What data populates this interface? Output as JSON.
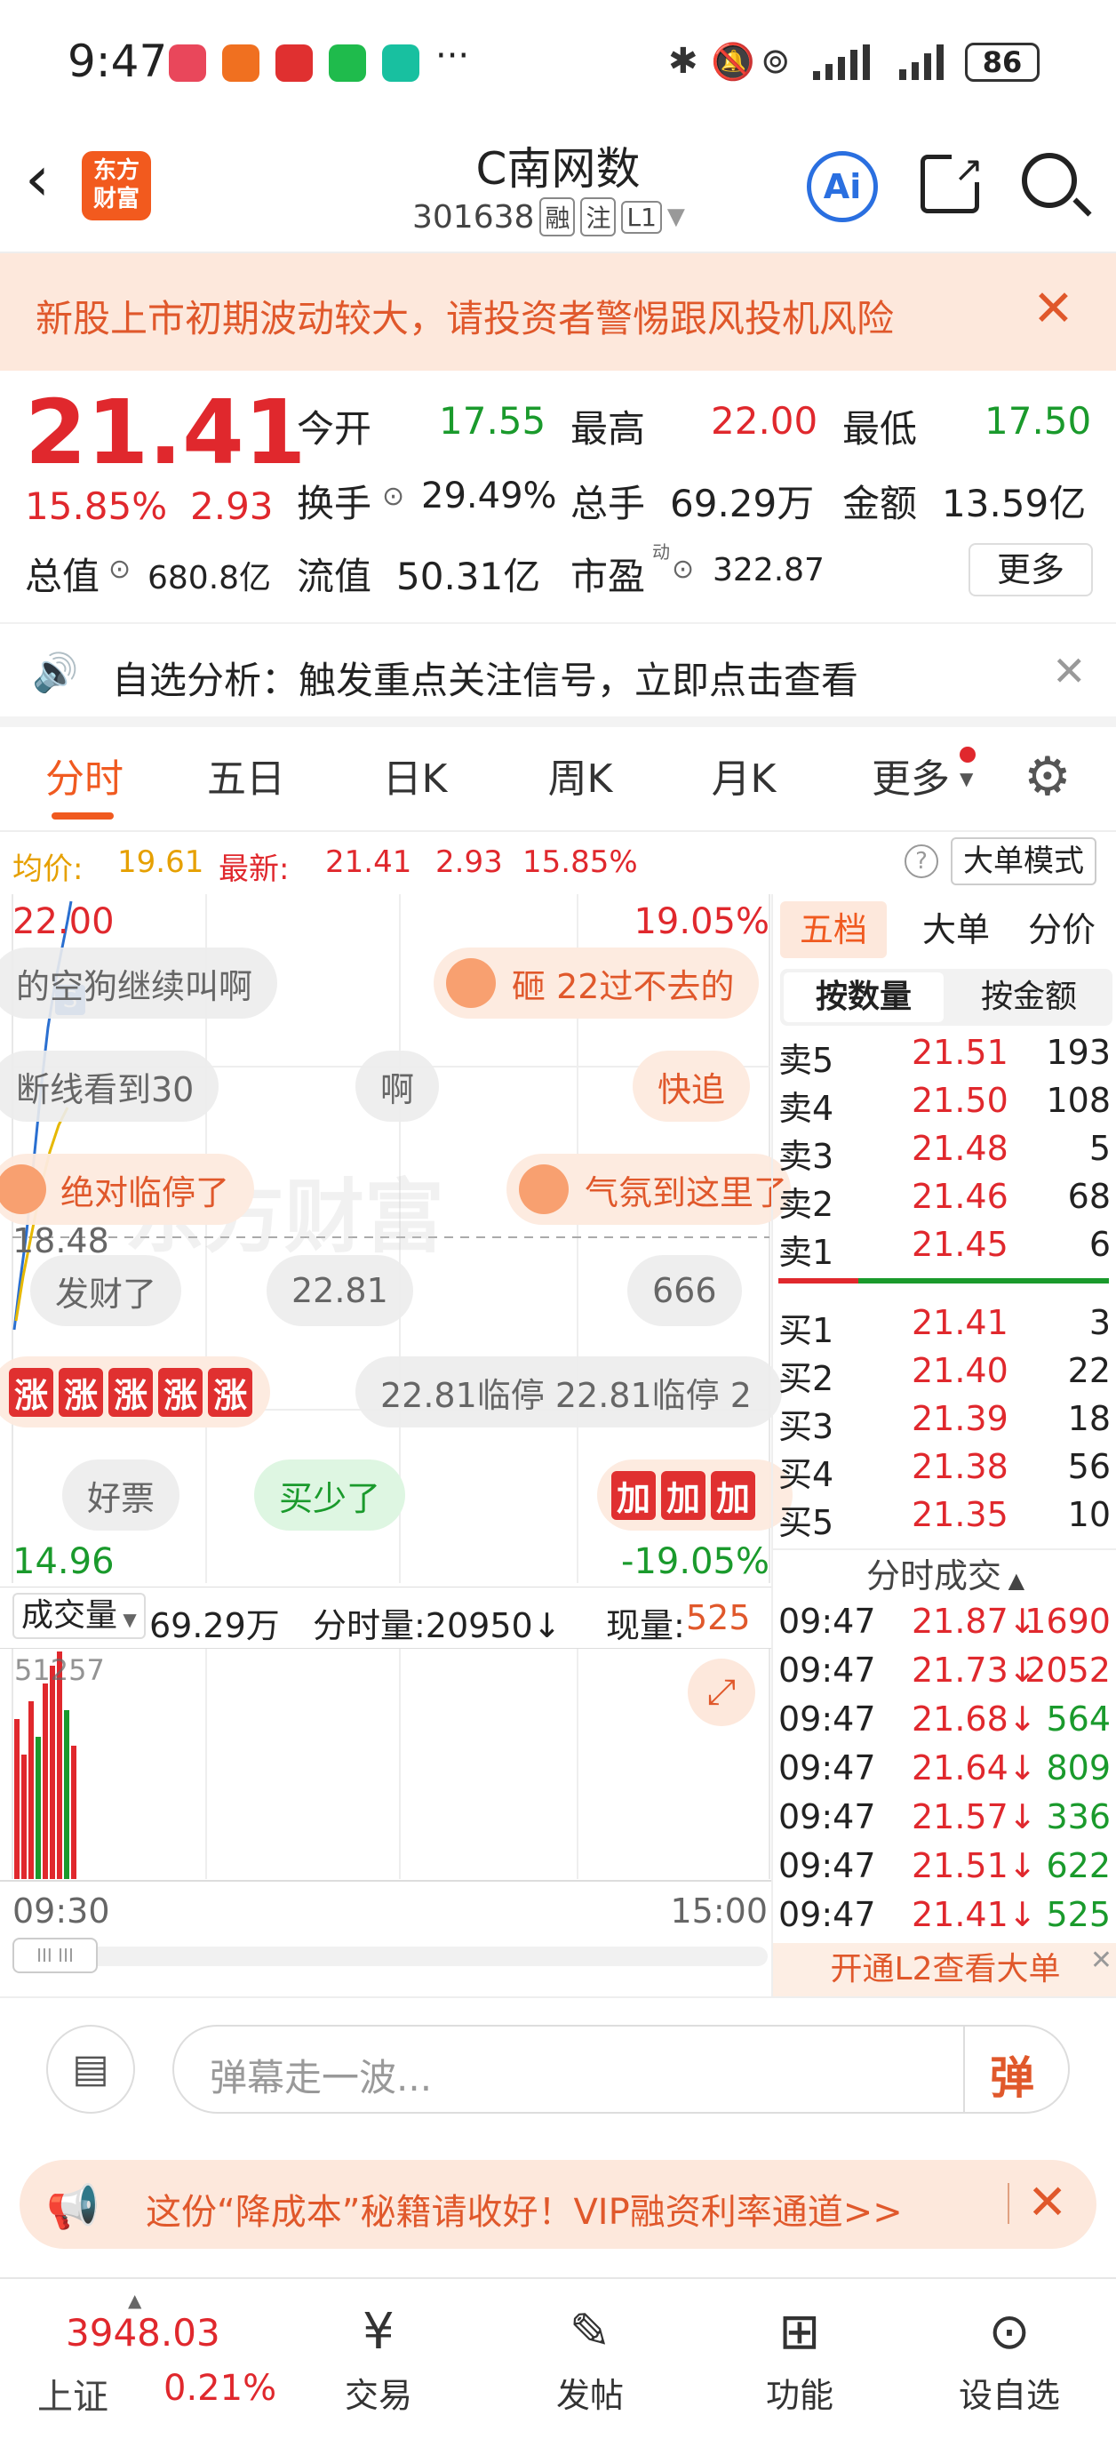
{
  "status": {
    "time": "9:47",
    "battery": "86",
    "more": "···"
  },
  "nav": {
    "title": "C南网数",
    "code": "301638",
    "tag_rong": "融",
    "tag_zhu": "注",
    "tag_level": "L1",
    "logo_line1": "东方",
    "logo_line2": "财富",
    "ai": "Ai"
  },
  "warning": {
    "text": "新股上市初期波动较大，请投资者警惕跟风投机风险"
  },
  "quote": {
    "price": "21.41",
    "pct": "15.85%",
    "change": "2.93",
    "open_label": "今开",
    "open": "17.55",
    "high_label": "最高",
    "high": "22.00",
    "low_label": "最低",
    "low": "17.50",
    "turnover_label": "换手",
    "turnover": "29.49%",
    "volume_label": "总手",
    "volume": "69.29万",
    "amount_label": "金额",
    "amount": "13.59亿",
    "mcap_label": "总值",
    "mcap": "680.8亿",
    "float_label": "流值",
    "float": "50.31亿",
    "pe_label": "市盈",
    "pe_sup": "动",
    "pe": "322.87",
    "more_btn": "更多"
  },
  "signal": {
    "text": "自选分析：触发重点关注信号，立即点击查看"
  },
  "ktabs": [
    "分时",
    "五日",
    "日K",
    "周K",
    "月K",
    "更多"
  ],
  "avg": {
    "avg_label": "均价:",
    "avg": "19.61",
    "latest_label": "最新:",
    "latest": "21.41",
    "chg": "2.93",
    "pct": "15.85%",
    "mode_btn": "大单模式",
    "help": "?"
  },
  "chart": {
    "top_price": "22.00",
    "top_pct": "19.05%",
    "mid_price": "18.48",
    "bottom_price": "14.96",
    "bottom_pct": "-19.05%",
    "watermark": "东方财富",
    "s_marker": "S",
    "vol_label": "成交量",
    "vol_total": "69.29万",
    "fs_label": "分时量:20950↓",
    "now_label": "现量:",
    "now_val": "525",
    "vol_max": "51257",
    "time_start": "09:30",
    "time_end": "15:00"
  },
  "danmaku": [
    {
      "text": "的空狗继续叫啊"
    },
    {
      "text": "砸 22过不去的"
    },
    {
      "text": "断线看到30"
    },
    {
      "text": "啊"
    },
    {
      "text": "快追"
    },
    {
      "text": "绝对临停了"
    },
    {
      "text": "气氛到这里了"
    },
    {
      "text": "发财了"
    },
    {
      "text": "22.81"
    },
    {
      "text": "666"
    },
    {
      "text": "22.81临停  22.81临停  2"
    },
    {
      "text": "好票"
    },
    {
      "text": "买少了"
    }
  ],
  "zhang": "涨",
  "jia": "加",
  "book": {
    "tabs": [
      "五档",
      "大单",
      "分价"
    ],
    "sub_tabs": [
      "按数量",
      "按金额"
    ],
    "asks": [
      {
        "label": "卖5",
        "price": "21.51",
        "qty": "193"
      },
      {
        "label": "卖4",
        "price": "21.50",
        "qty": "108"
      },
      {
        "label": "卖3",
        "price": "21.48",
        "qty": "5"
      },
      {
        "label": "卖2",
        "price": "21.46",
        "qty": "68"
      },
      {
        "label": "卖1",
        "price": "21.45",
        "qty": "6"
      }
    ],
    "bids": [
      {
        "label": "买1",
        "price": "21.41",
        "qty": "3"
      },
      {
        "label": "买2",
        "price": "21.40",
        "qty": "22"
      },
      {
        "label": "买3",
        "price": "21.39",
        "qty": "18"
      },
      {
        "label": "买4",
        "price": "21.38",
        "qty": "56"
      },
      {
        "label": "买5",
        "price": "21.35",
        "qty": "10"
      }
    ],
    "trades_title": "分时成交",
    "trades": [
      {
        "t": "09:47",
        "p": "21.87↓",
        "v": "1690"
      },
      {
        "t": "09:47",
        "p": "21.73↓",
        "v": "2052"
      },
      {
        "t": "09:47",
        "p": "21.68↓",
        "v": "564"
      },
      {
        "t": "09:47",
        "p": "21.64↓",
        "v": "809"
      },
      {
        "t": "09:47",
        "p": "21.57↓",
        "v": "336"
      },
      {
        "t": "09:47",
        "p": "21.51↓",
        "v": "622"
      },
      {
        "t": "09:47",
        "p": "21.41↓",
        "v": "525"
      }
    ],
    "l2": "开通L2查看大单"
  },
  "danmu_input": {
    "placeholder": "弹幕走一波...",
    "send": "弹"
  },
  "ad": {
    "text": "这份“降成本”秘籍请收好！VIP融资利率通道>>"
  },
  "tabbar": {
    "index_val": "3948.03",
    "index_name": "上证",
    "index_pct": "0.21%",
    "items": [
      "交易",
      "发帖",
      "功能",
      "设自选"
    ]
  }
}
